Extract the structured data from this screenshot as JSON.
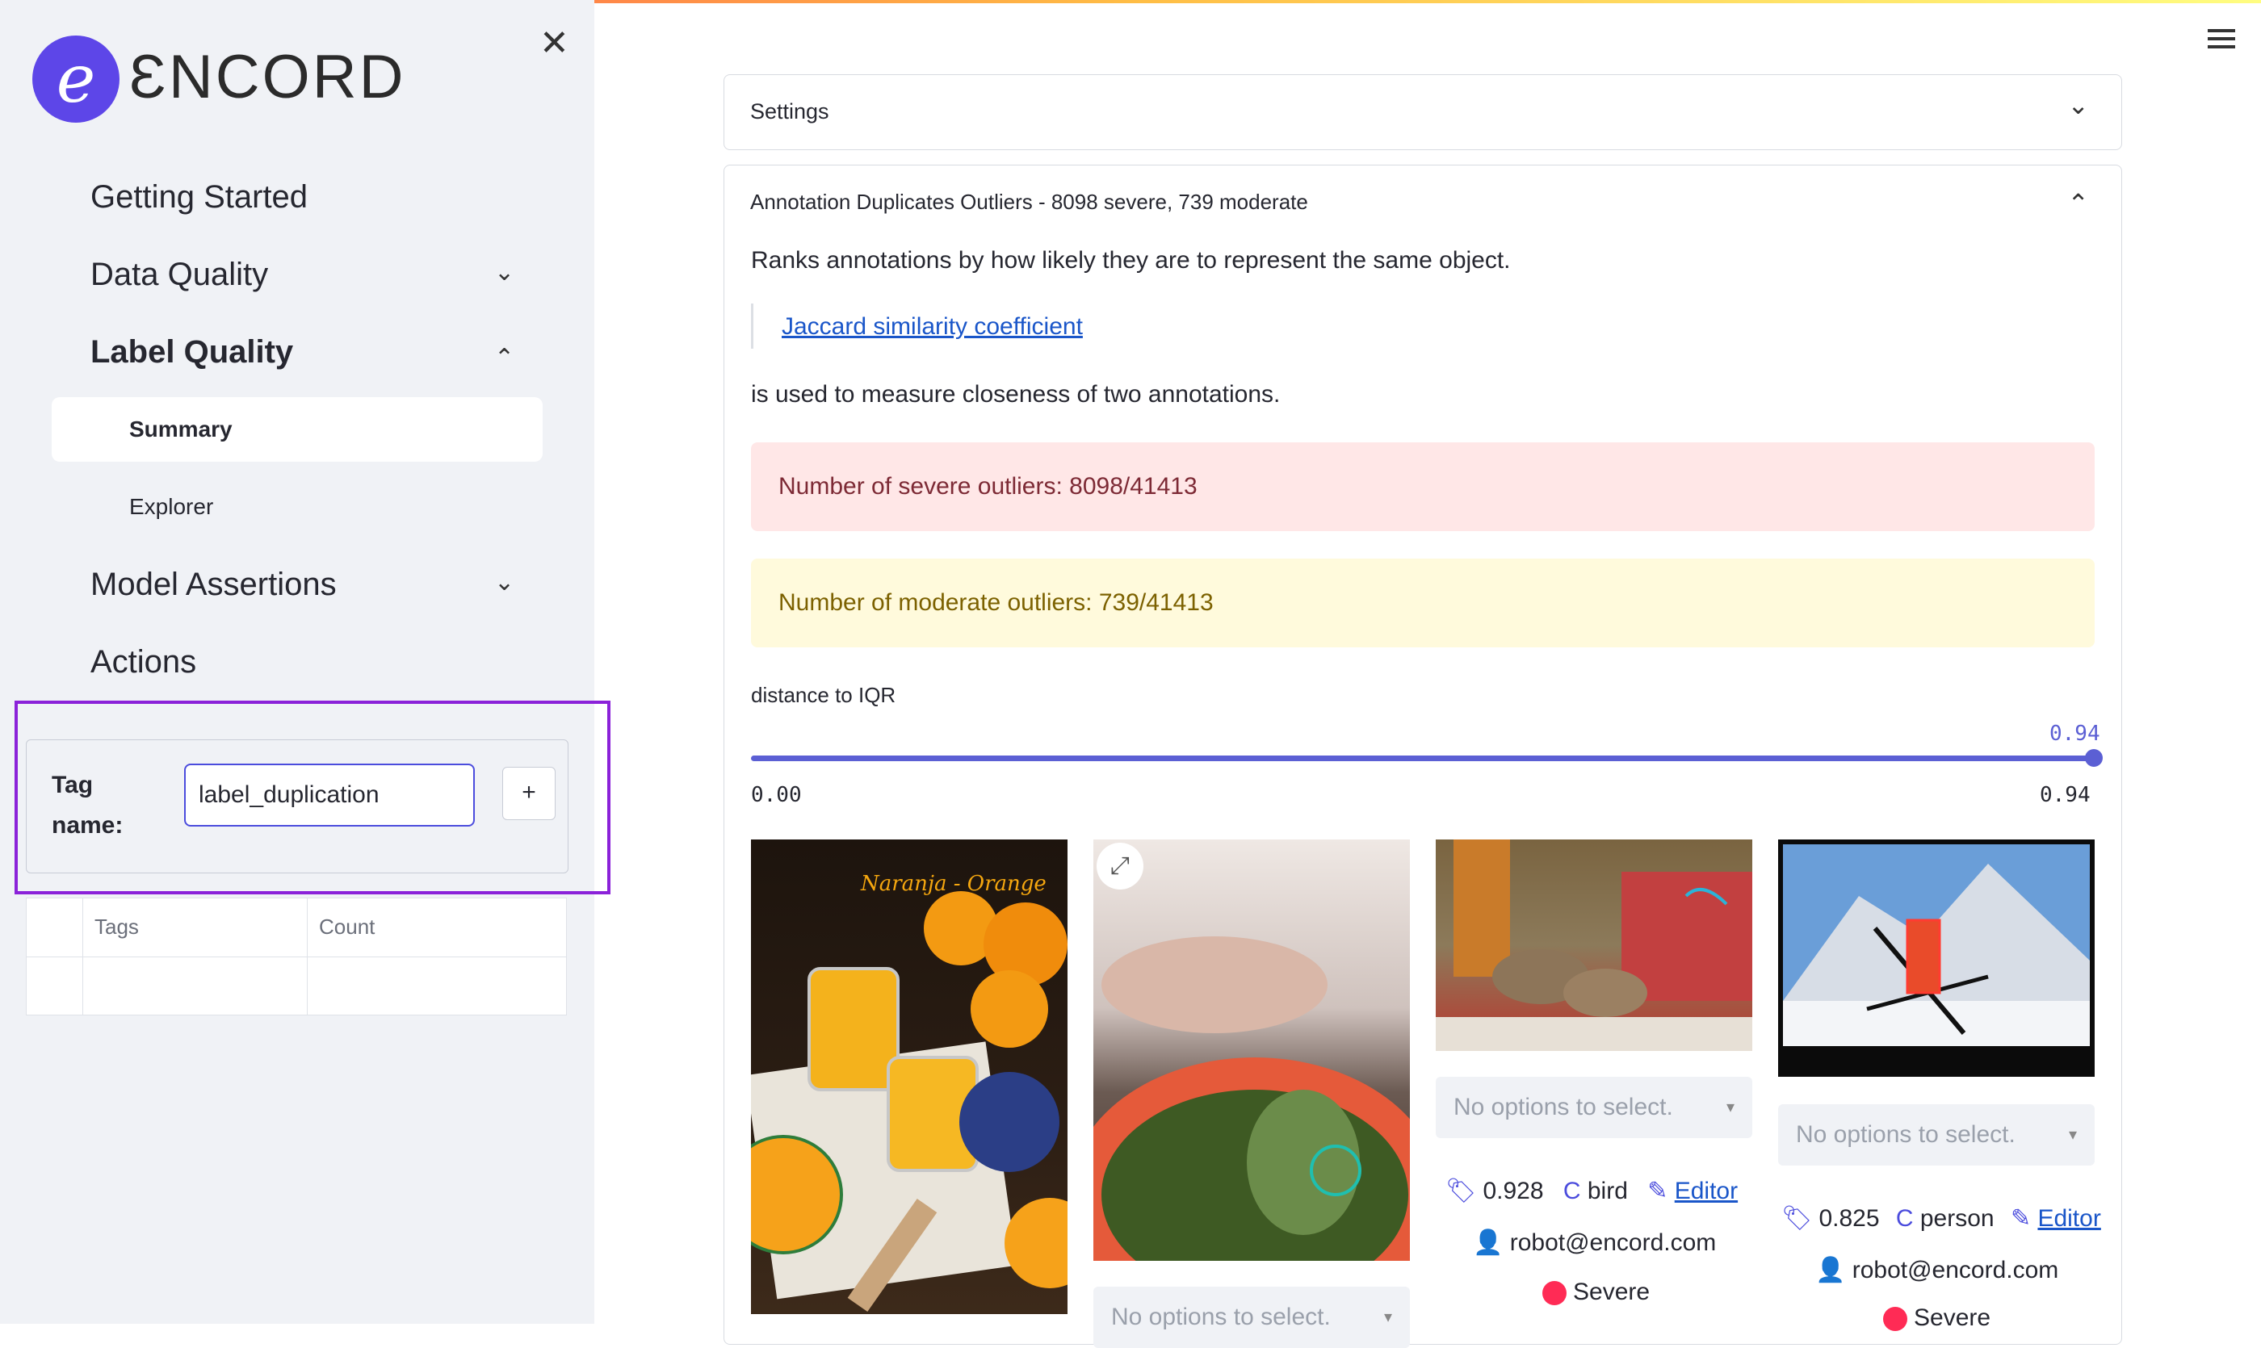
{
  "brand": {
    "logo_letter": "e",
    "name": "ƐNCORD"
  },
  "sidebar": {
    "nav": [
      {
        "label": "Getting Started"
      },
      {
        "label": "Data Quality"
      },
      {
        "label": "Label Quality"
      },
      {
        "label": "Model Assertions"
      },
      {
        "label": "Actions"
      }
    ],
    "label_quality_sub": [
      {
        "label": "Summary"
      },
      {
        "label": "Explorer"
      }
    ],
    "tag_form": {
      "label": "Tag name:",
      "value": "label_duplication",
      "add_label": "+"
    },
    "tags_table": {
      "headers": [
        "Tags",
        "Count"
      ]
    }
  },
  "settings": {
    "title": "Settings"
  },
  "outliers": {
    "title": "Annotation Duplicates Outliers - 8098 severe, 739 moderate",
    "description": "Ranks annotations by how likely they are to represent the same object.",
    "link_text": "Jaccard similarity coefficient",
    "after_link": "is used to measure closeness of two annotations.",
    "severe_alert": "Number of severe outliers: 8098/41413",
    "moderate_alert": "Number of moderate outliers: 739/41413",
    "slider": {
      "label": "distance to IQR",
      "value": "0.94",
      "min": "0.00",
      "max": "0.94"
    }
  },
  "gallery": {
    "image1_caption": "Naranja - Orange",
    "items": [
      {
        "select_placeholder": "No options to select.",
        "score": "0.928",
        "class": "bird",
        "editor": "Editor",
        "user": "robot@encord.com",
        "severity": "Severe"
      },
      {
        "select_placeholder": "No options to select.",
        "score": "0.825",
        "class": "person",
        "editor": "Editor",
        "user": "robot@encord.com",
        "severity": "Severe"
      },
      {
        "select_placeholder": "No options to select."
      }
    ]
  },
  "colors": {
    "accent": "#5b5fd4",
    "severe_bg": "#ffe7e7",
    "moderate_bg": "#fffadc",
    "highlight_border": "#8b22d9"
  }
}
